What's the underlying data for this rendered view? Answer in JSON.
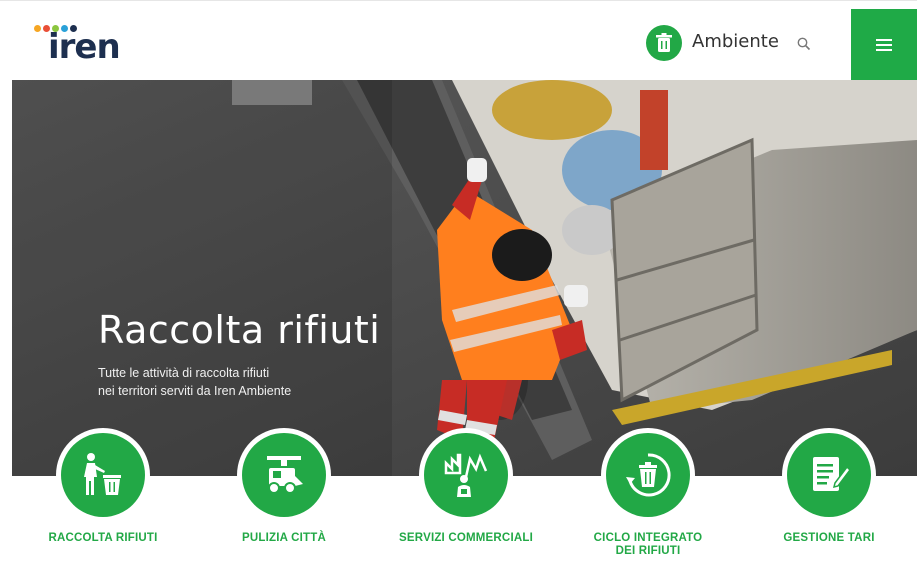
{
  "brand": {
    "logo_text": "iren",
    "dot_colors": [
      "#f6a623",
      "#e94f37",
      "#8cc63f",
      "#2aa1d8",
      "#1d2f4f"
    ]
  },
  "header": {
    "section_label": "Ambiente",
    "accent": "#22a846"
  },
  "hero": {
    "title": "Raccolta rifiuti",
    "subtitle_line1": "Tutte le attività di raccolta rifiuti",
    "subtitle_line2": "nei territori serviti da Iren Ambiente",
    "slides_count": 5,
    "active_slide": 1
  },
  "services": [
    {
      "label_line1": "RACCOLTA RIFIUTI",
      "label_line2": "",
      "icon": "person-trash-icon"
    },
    {
      "label_line1": "PULIZIA CITTÀ",
      "label_line2": "",
      "icon": "street-sweeper-icon"
    },
    {
      "label_line1": "SERVIZI COMMERCIALI",
      "label_line2": "",
      "icon": "commercial-services-icon"
    },
    {
      "label_line1": "CICLO INTEGRATO",
      "label_line2": "DEI RIFIUTI",
      "icon": "recycle-bin-icon"
    },
    {
      "label_line1": "GESTIONE TARI",
      "label_line2": "",
      "icon": "document-edit-icon"
    }
  ]
}
